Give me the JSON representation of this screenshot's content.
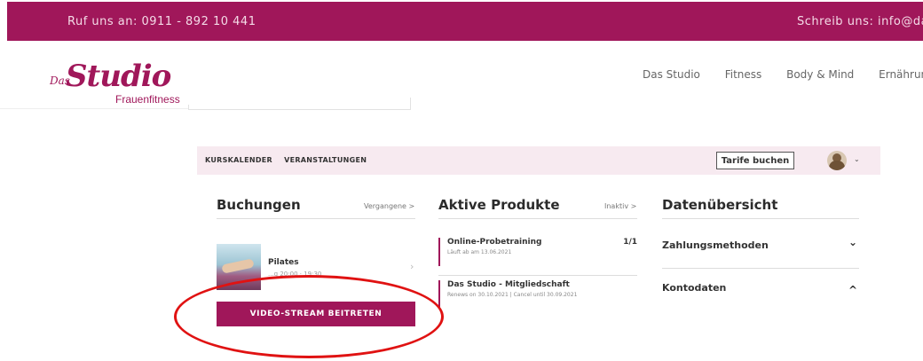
{
  "topbar": {
    "phone": "Ruf uns an: 0911 - 892 10 441",
    "email": "Schreib uns: info@das"
  },
  "logo": {
    "das": "Das",
    "studio": "Studio",
    "subtitle": "Frauenfitness"
  },
  "nav": {
    "items": [
      "Das Studio",
      "Fitness",
      "Body & Mind",
      "Ernährung"
    ]
  },
  "subnav": {
    "kurskalender": "KURSKALENDER",
    "veranstaltungen": "VERANSTALTUNGEN",
    "tarife": "Tarife buchen",
    "caret": "⌄"
  },
  "buchungen": {
    "title": "Buchungen",
    "link": "Vergangene >",
    "item_title": "Pilates",
    "item_sub": "...g 20:00 · 19:30",
    "chevron": "›",
    "video_button": "VIDEO-STREAM BEITRETEN"
  },
  "produkte": {
    "title": "Aktive Produkte",
    "link": "Inaktiv >",
    "items": [
      {
        "title": "Online-Probetraining",
        "sub": "Läuft ab am 13.06.2021",
        "count": "1/1"
      },
      {
        "title": "Das Studio - Mitgliedschaft",
        "sub": "Renews on 30.10.2021 | Cancel until 30.09.2021",
        "count": ""
      }
    ]
  },
  "daten": {
    "title": "Datenübersicht",
    "items": [
      {
        "label": "Zahlungsmethoden",
        "chevron": "⌄"
      },
      {
        "label": "Kontodaten",
        "chevron": "^"
      }
    ]
  },
  "colors": {
    "brand": "#a0175a",
    "subnav_bg": "#f7eaf0",
    "annotation": "#e01212"
  }
}
